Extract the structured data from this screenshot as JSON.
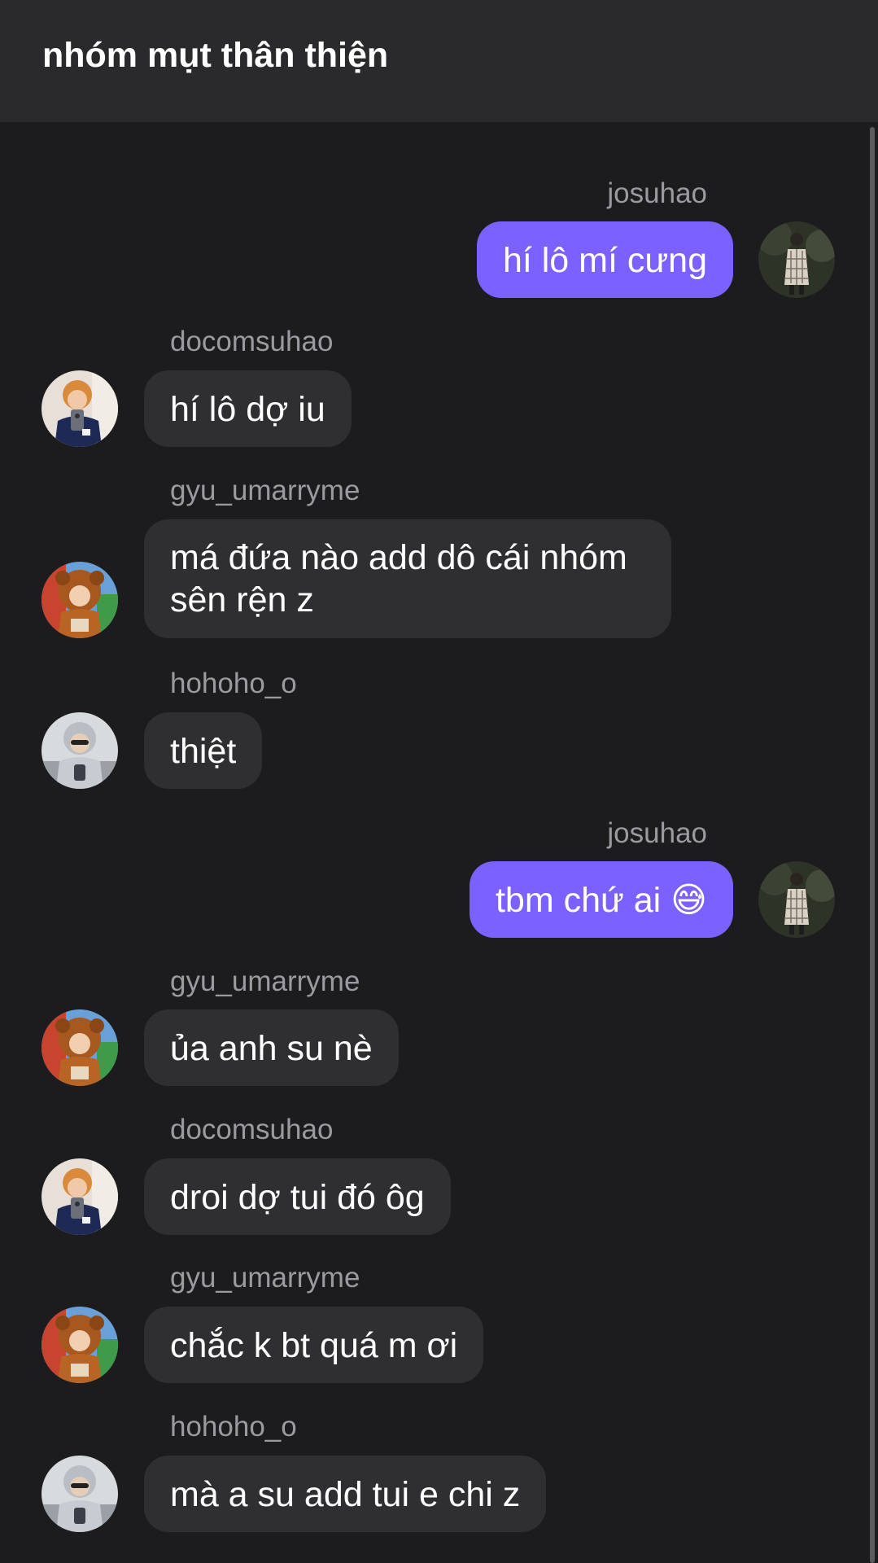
{
  "header": {
    "title": "nhóm mụt thân thiện"
  },
  "messages": [
    {
      "sender": "josuhao",
      "text": "hí lô mí cưng",
      "outgoing": true,
      "avatar": "avatar-josuhao"
    },
    {
      "sender": "docomsuhao",
      "text": "hí lô dợ iu",
      "outgoing": false,
      "avatar": "avatar-docomsuhao"
    },
    {
      "sender": "gyu_umarryme",
      "text": "má đứa nào add dô cái nhóm sên rện z",
      "outgoing": false,
      "avatar": "avatar-gyu"
    },
    {
      "sender": "hohoho_o",
      "text": "thiệt",
      "outgoing": false,
      "avatar": "avatar-hohoho"
    },
    {
      "sender": "josuhao",
      "text": "tbm chứ ai 😅",
      "outgoing": true,
      "avatar": "avatar-josuhao"
    },
    {
      "sender": "gyu_umarryme",
      "text": "ủa anh su nè",
      "outgoing": false,
      "avatar": "avatar-gyu"
    },
    {
      "sender": "docomsuhao",
      "text": "droi dợ tui đó ôg",
      "outgoing": false,
      "avatar": "avatar-docomsuhao"
    },
    {
      "sender": "gyu_umarryme",
      "text": "chắc k bt quá m ơi",
      "outgoing": false,
      "avatar": "avatar-gyu"
    },
    {
      "sender": "hohoho_o",
      "text": "mà a su add tui e chi z",
      "outgoing": false,
      "avatar": "avatar-hohoho"
    }
  ],
  "colors": {
    "background": "#1c1c1e",
    "header": "#2a2a2c",
    "incoming_bubble": "#2f2f32",
    "outgoing_bubble": "#7b61ff",
    "sender_name": "#9a9aa0"
  }
}
